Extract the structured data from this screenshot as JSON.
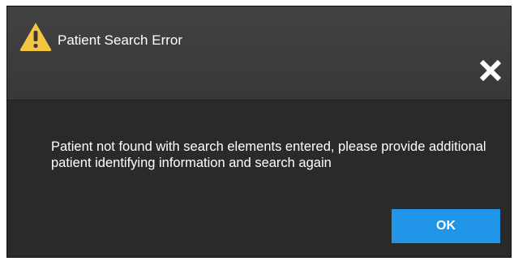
{
  "dialog": {
    "title": "Patient Search Error",
    "title_icon": "warning-triangle-icon",
    "close_icon": "close-icon",
    "message": "Patient not found with search elements entered, please provide additional patient identifying information and search again",
    "ok_label": "OK"
  },
  "colors": {
    "titlebar": "#3c3c3c",
    "body": "#2a2a2a",
    "warning": "#f5c542",
    "ok_button": "#2196e8",
    "text": "#ffffff"
  }
}
